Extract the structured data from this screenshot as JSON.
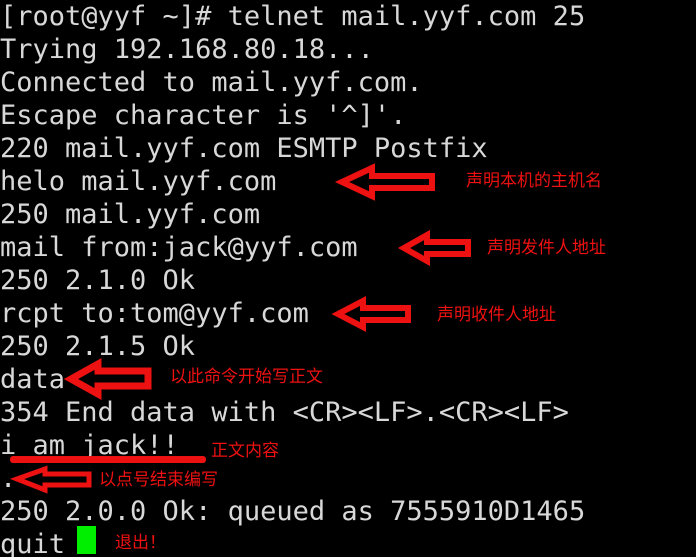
{
  "terminal": {
    "background_color": "#000000",
    "text_color": "#d8d8d8",
    "annotation_color": "#ee1111",
    "cursor_color": "#00ef00",
    "lines": [
      {
        "text": "[root@yyf ~]# telnet mail.yyf.com 25"
      },
      {
        "text": "Trying 192.168.80.18..."
      },
      {
        "text": "Connected to mail.yyf.com."
      },
      {
        "text": "Escape character is '^]'."
      },
      {
        "text": "220 mail.yyf.com ESMTP Postfix"
      },
      {
        "text": "helo mail.yyf.com"
      },
      {
        "text": "250 mail.yyf.com"
      },
      {
        "text": "mail from:jack@yyf.com"
      },
      {
        "text": "250 2.1.0 Ok"
      },
      {
        "text": "rcpt to:tom@yyf.com"
      },
      {
        "text": "250 2.1.5 Ok"
      },
      {
        "text": "data"
      },
      {
        "text": "354 End data with <CR><LF>.<CR><LF>"
      },
      {
        "text": "i am jack!!"
      },
      {
        "text": "."
      },
      {
        "text": "250 2.0.0 Ok: queued as 7555910D1465"
      },
      {
        "text": "quit"
      }
    ]
  },
  "annotations": [
    {
      "id": "hostname-note",
      "text": "声明本机的主机名"
    },
    {
      "id": "sender-note",
      "text": "声明发件人地址"
    },
    {
      "id": "recipient-note",
      "text": "声明收件人地址"
    },
    {
      "id": "data-note",
      "text": "以此命令开始写正文"
    },
    {
      "id": "body-note",
      "text": "正文内容"
    },
    {
      "id": "end-note",
      "text": "以点号结束编写"
    },
    {
      "id": "quit-note",
      "text": "退出！"
    }
  ]
}
